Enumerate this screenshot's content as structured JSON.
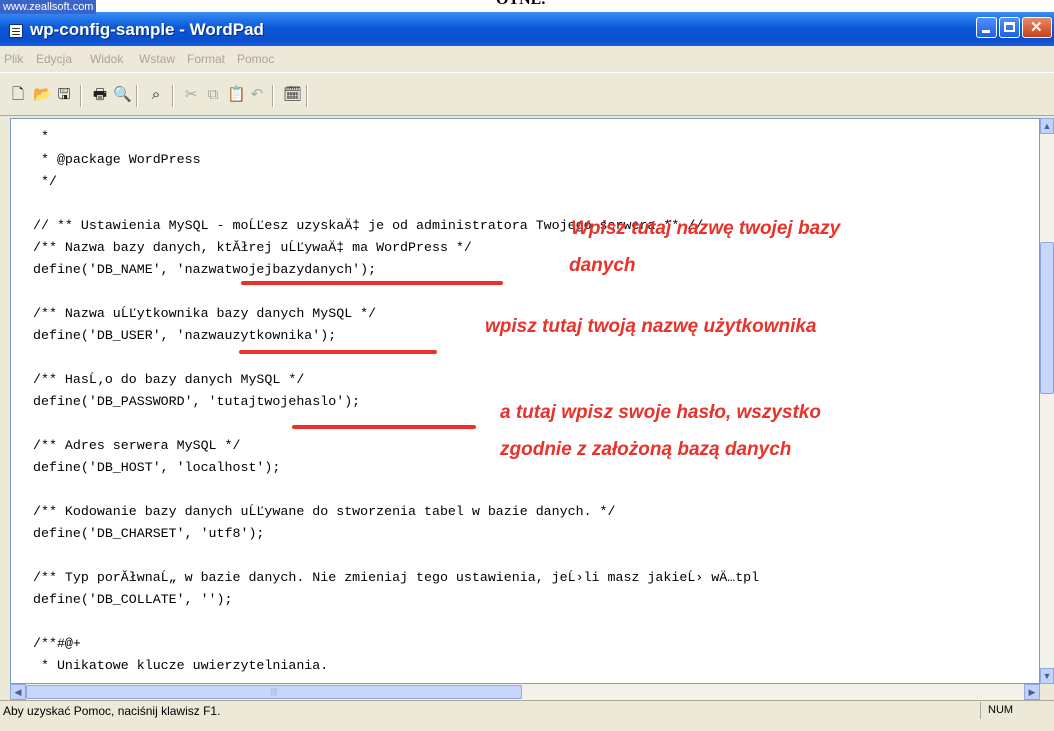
{
  "watermark": "www.zeallsoft.com",
  "caption_top": "OTNE.",
  "window": {
    "title": "wp-config-sample - WordPad"
  },
  "menu": [
    "Plik",
    "Edycja",
    "Widok",
    "Wstaw",
    "Format",
    "Pomoc"
  ],
  "toolbar_icons": [
    "new-document-icon",
    "open-folder-icon",
    "save-icon",
    "print-icon",
    "print-preview-icon",
    "find-icon",
    "cut-icon",
    "copy-icon",
    "paste-icon",
    "undo-icon",
    "insert-date-time-icon"
  ],
  "code_lines": [
    " *",
    " * @package WordPress",
    " */",
    "",
    "// ** Ustawienia MySQL - moĹĽesz uzyskaÄ‡ je od administratora Twojego serwera ** //",
    "/** Nazwa bazy danych, ktĂłrej uĹĽywaÄ‡ ma WordPress */",
    "define('DB_NAME', 'nazwatwojejbazydanych');",
    "",
    "/** Nazwa uĹĽytkownika bazy danych MySQL */",
    "define('DB_USER', 'nazwauzytkownika');",
    "",
    "/** HasĹ‚o do bazy danych MySQL */",
    "define('DB_PASSWORD', 'tutajtwojehaslo');",
    "",
    "/** Adres serwera MySQL */",
    "define('DB_HOST', 'localhost');",
    "",
    "/** Kodowanie bazy danych uĹĽywane do stworzenia tabel w bazie danych. */",
    "define('DB_CHARSET', 'utf8');",
    "",
    "/** Typ porĂłwnaĹ„ w bazie danych. Nie zmieniaj tego ustawienia, jeĹ›li masz jakieĹ› wÄ…tpl",
    "define('DB_COLLATE', '');",
    "",
    "/**#@+",
    " * Unikatowe klucze uwierzytelniania."
  ],
  "annotations": {
    "db_name_1": "Wpisz tutaj nazwę twojej bazy",
    "db_name_2": "danych",
    "db_user": "wpisz tutaj twoją nazwę użytkownika",
    "db_pass_1": "a tutaj wpisz swoje hasło, wszystko",
    "db_pass_2": "zgodnie z założoną bazą danych"
  },
  "status": {
    "help": "Aby uzyskać Pomoc, naciśnij klawisz F1.",
    "num": "NUM"
  },
  "colors": {
    "titlebar": "#0a5ad8",
    "annotation": "#e8322a",
    "chrome": "#ece9d8"
  }
}
